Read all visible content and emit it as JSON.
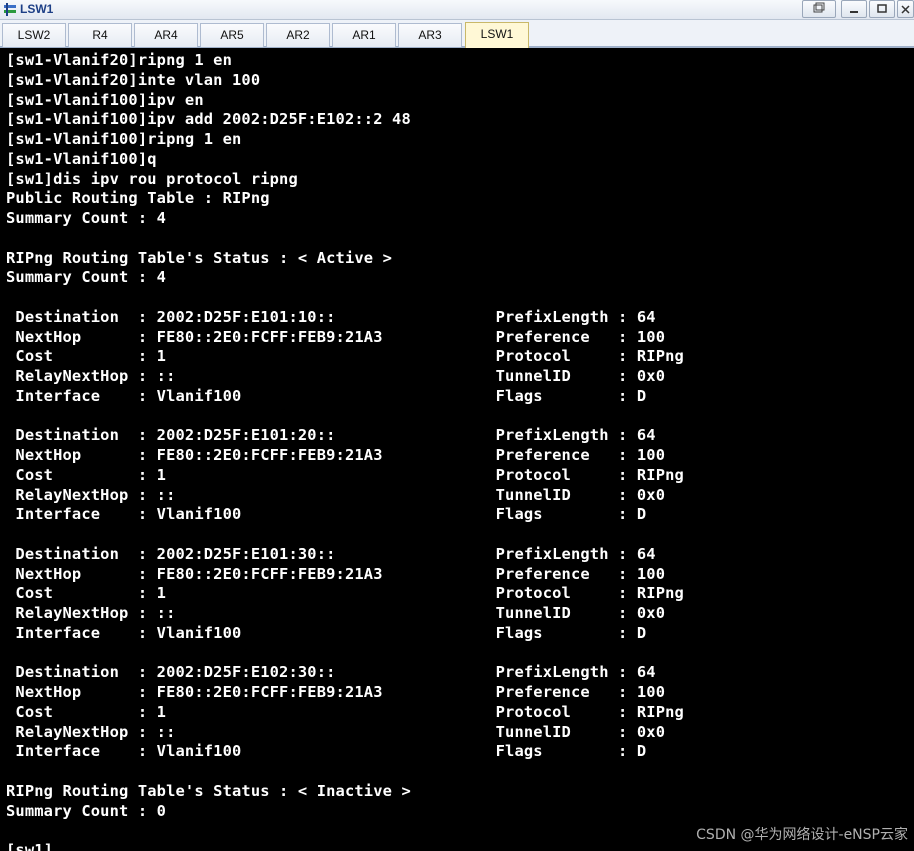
{
  "window": {
    "title": "LSW1"
  },
  "tabs": [
    "LSW2",
    "R4",
    "AR4",
    "AR5",
    "AR2",
    "AR1",
    "AR3",
    "LSW1"
  ],
  "active_tab": "LSW1",
  "terminal": {
    "lines": [
      "[sw1-Vlanif20]ripng 1 en",
      "[sw1-Vlanif20]inte vlan 100",
      "[sw1-Vlanif100]ipv en",
      "[sw1-Vlanif100]ipv add 2002:D25F:E102::2 48",
      "[sw1-Vlanif100]ripng 1 en",
      "[sw1-Vlanif100]q",
      "[sw1]dis ipv rou protocol ripng",
      "Public Routing Table : RIPng",
      "Summary Count : 4",
      "",
      "RIPng Routing Table's Status : < Active >",
      "Summary Count : 4",
      "",
      " Destination  : 2002:D25F:E101:10::                 PrefixLength : 64",
      " NextHop      : FE80::2E0:FCFF:FEB9:21A3            Preference   : 100",
      " Cost         : 1                                   Protocol     : RIPng",
      " RelayNextHop : ::                                  TunnelID     : 0x0",
      " Interface    : Vlanif100                           Flags        : D",
      "",
      " Destination  : 2002:D25F:E101:20::                 PrefixLength : 64",
      " NextHop      : FE80::2E0:FCFF:FEB9:21A3            Preference   : 100",
      " Cost         : 1                                   Protocol     : RIPng",
      " RelayNextHop : ::                                  TunnelID     : 0x0",
      " Interface    : Vlanif100                           Flags        : D",
      "",
      " Destination  : 2002:D25F:E101:30::                 PrefixLength : 64",
      " NextHop      : FE80::2E0:FCFF:FEB9:21A3            Preference   : 100",
      " Cost         : 1                                   Protocol     : RIPng",
      " RelayNextHop : ::                                  TunnelID     : 0x0",
      " Interface    : Vlanif100                           Flags        : D",
      "",
      " Destination  : 2002:D25F:E102:30::                 PrefixLength : 64",
      " NextHop      : FE80::2E0:FCFF:FEB9:21A3            Preference   : 100",
      " Cost         : 1                                   Protocol     : RIPng",
      " RelayNextHop : ::                                  TunnelID     : 0x0",
      " Interface    : Vlanif100                           Flags        : D",
      "",
      "RIPng Routing Table's Status : < Inactive >",
      "Summary Count : 0",
      "",
      "[sw1]"
    ]
  },
  "watermark": "CSDN @华为网络设计-eNSP云家"
}
